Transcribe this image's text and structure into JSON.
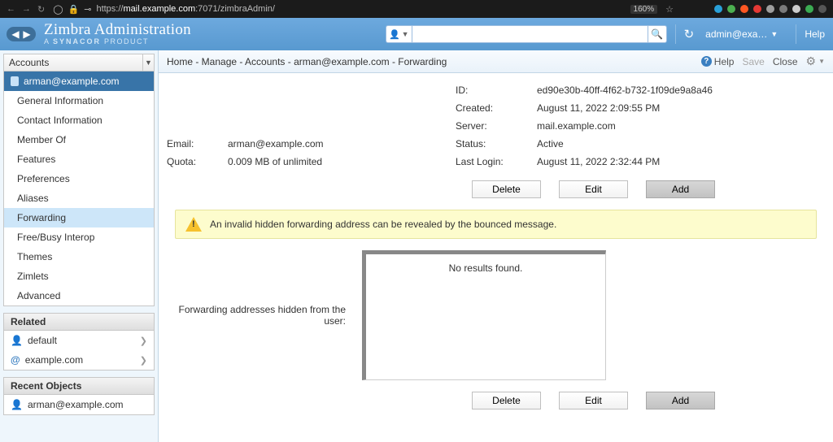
{
  "browser": {
    "url_prefix": "https://",
    "url_host": "mail.example.com",
    "url_path": ":7071/zimbraAdmin/",
    "zoom": "160%"
  },
  "header": {
    "title": "Zimbra Administration",
    "subtitle_a": "A ",
    "subtitle_b": "SYNACOR",
    "subtitle_c": " PRODUCT",
    "user": "admin@exa…",
    "help": "Help"
  },
  "sidebar": {
    "selector": "Accounts",
    "account": "arman@example.com",
    "items": [
      "General Information",
      "Contact Information",
      "Member Of",
      "Features",
      "Preferences",
      "Aliases",
      "Forwarding",
      "Free/Busy Interop",
      "Themes",
      "Zimlets",
      "Advanced"
    ],
    "related_header": "Related",
    "related": [
      {
        "icon": "user",
        "label": "default"
      },
      {
        "icon": "at",
        "label": "example.com"
      }
    ],
    "recent_header": "Recent Objects",
    "recent": [
      {
        "icon": "user",
        "label": "arman@example.com"
      }
    ]
  },
  "crumb": "Home - Manage - Accounts - arman@example.com - Forwarding",
  "top_actions": {
    "help": "Help",
    "save": "Save",
    "close": "Close"
  },
  "info": {
    "email_k": "Email:",
    "email_v": "arman@example.com",
    "quota_k": "Quota:",
    "quota_v": "0.009 MB of unlimited",
    "id_k": "ID:",
    "id_v": "ed90e30b-40ff-4f62-b732-1f09de9a8a46",
    "created_k": "Created:",
    "created_v": "August 11, 2022 2:09:55 PM",
    "server_k": "Server:",
    "server_v": "mail.example.com",
    "status_k": "Status:",
    "status_v": "Active",
    "login_k": "Last Login:",
    "login_v": "August 11, 2022 2:32:44 PM"
  },
  "buttons": {
    "delete": "Delete",
    "edit": "Edit",
    "add": "Add"
  },
  "alert": "An invalid hidden forwarding address can be revealed by the bounced message.",
  "hidden_label": "Forwarding addresses hidden from the user:",
  "no_results": "No results found."
}
